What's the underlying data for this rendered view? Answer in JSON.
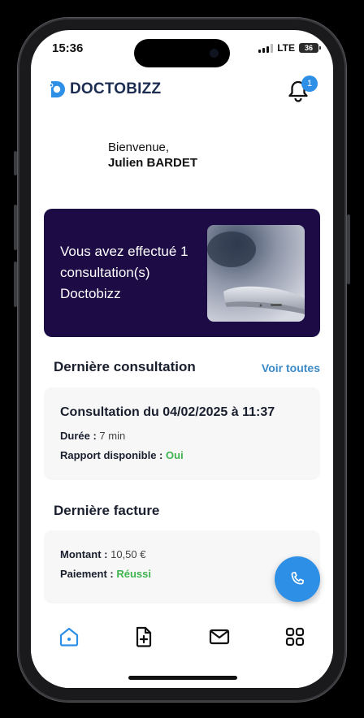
{
  "status_bar": {
    "time": "15:36",
    "network": "LTE",
    "battery": "36"
  },
  "header": {
    "logo_text": "DOCTOBIZZ",
    "notification_count": "1"
  },
  "welcome": {
    "greeting": "Bienvenue,",
    "user_name": "Julien BARDET"
  },
  "banner": {
    "text": "Vous avez effectué 1 consultation(s) Doctobizz"
  },
  "last_consultation": {
    "section_title": "Dernière consultation",
    "see_all": "Voir toutes",
    "title": "Consultation du 04/02/2025 à 11:37",
    "duration_label": "Durée :",
    "duration_value": "7 min",
    "report_label": "Rapport disponible :",
    "report_value": "Oui"
  },
  "last_invoice": {
    "section_title": "Dernière facture",
    "amount_label": "Montant :",
    "amount_value": "10,50 €",
    "payment_label": "Paiement :",
    "payment_value": "Réussi"
  },
  "colors": {
    "accent": "#2e8fe6",
    "banner_bg": "#1c0b44",
    "success": "#3fb34f",
    "link": "#3b8ac8"
  },
  "bottom_nav": [
    "home-icon",
    "add-document-icon",
    "mail-icon",
    "grid-icon"
  ]
}
